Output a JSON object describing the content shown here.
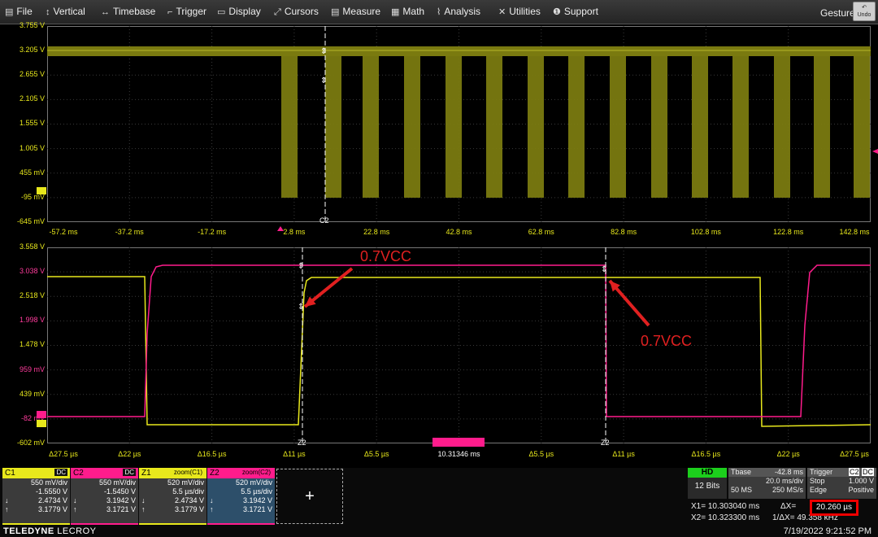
{
  "menu": [
    {
      "icon": "file-icon",
      "glyph": "▤",
      "label": "File"
    },
    {
      "icon": "vertical-icon",
      "glyph": "↕",
      "label": "Vertical"
    },
    {
      "icon": "timebase-icon",
      "glyph": "↔",
      "label": "Timebase"
    },
    {
      "icon": "trigger-icon",
      "glyph": "⌐",
      "label": "Trigger"
    },
    {
      "icon": "display-icon",
      "glyph": "▭",
      "label": "Display"
    },
    {
      "icon": "cursors-icon",
      "glyph": "⤢",
      "label": "Cursors"
    },
    {
      "icon": "measure-icon",
      "glyph": "▤",
      "label": "Measure"
    },
    {
      "icon": "math-icon",
      "glyph": "▦",
      "label": "Math"
    },
    {
      "icon": "analysis-icon",
      "glyph": "⌇",
      "label": "Analysis"
    },
    {
      "icon": "utilities-icon",
      "glyph": "✕",
      "label": "Utilities"
    },
    {
      "icon": "support-icon",
      "glyph": "❶",
      "label": "Support"
    }
  ],
  "gesture_label": "Gesture",
  "undo_label": "Undo",
  "colors": {
    "c1": "#e8e81c",
    "c2": "#ff1c8c",
    "z1": "#e8e81c",
    "z2": "#ff1c8c",
    "trace1": "#7a7a10",
    "red": "#e02020",
    "hd": "#1ccf1c",
    "ax": "#e8e81c",
    "ax2": "#ff3c9c"
  },
  "top_grid": {
    "ylabels": [
      "3.755 V",
      "3.205 V",
      "2.655 V",
      "2.105 V",
      "1.555 V",
      "1.005 V",
      "455 mV",
      "-95 mV",
      "-645 mV"
    ],
    "xlabels": [
      "-57.2 ms",
      "-37.2 ms",
      "-17.2 ms",
      "2.8 ms",
      "22.8 ms",
      "42.8 ms",
      "62.8 ms",
      "82.8 ms",
      "102.8 ms",
      "122.8 ms",
      "142.8 ms"
    ],
    "channel_tag": "C1",
    "cursor_tag": "C2"
  },
  "bottom_grid": {
    "ylabels": [
      "3.558 V",
      "3.038 V",
      "2.518 V",
      "1.998 V",
      "1.478 V",
      "959 mV",
      "439 mV",
      "-82 mV",
      "-602 mV"
    ],
    "xlabels": [
      "Δ27.5 µs",
      "Δ22 µs",
      "Δ16.5 µs",
      "Δ11 µs",
      "Δ5.5 µs",
      "10.31346 ms",
      "Δ5.5 µs",
      "Δ11 µs",
      "Δ16.5 µs",
      "Δ22 µs",
      "Δ27.5 µs"
    ],
    "tags": [
      "Z2",
      "Z1"
    ],
    "cursor_tags": [
      "Z2",
      "Z2"
    ],
    "annotations": [
      "0.7VCC",
      "0.7VCC"
    ]
  },
  "tiles": [
    {
      "name": "C1",
      "dc": "DC",
      "div": "550 mV/div",
      "offset": "-1.5550 V",
      "v1": "2.4734 V",
      "v2": "3.1779 V"
    },
    {
      "name": "C2",
      "dc": "DC",
      "div": "550 mV/div",
      "offset": "-1.5450 V",
      "v1": "3.1942 V",
      "v2": "3.1721 V"
    },
    {
      "name": "Z1",
      "right": "zoom(C1)",
      "div": "520 mV/div",
      "offset": "5.5 µs/div",
      "v1": "2.4734 V",
      "v2": "3.1779 V"
    },
    {
      "name": "Z2",
      "right": "zoom(C2)",
      "div": "520 mV/div",
      "offset": "5.5 µs/div",
      "v1": "3.1942 V",
      "v2": "3.1721 V"
    }
  ],
  "add_label": "+",
  "hd": {
    "label": "HD",
    "bits": "12 Bits"
  },
  "tbase": {
    "label": "Tbase",
    "offset": "-42.8 ms",
    "div": "20.0 ms/div",
    "rate1": "50 MS",
    "rate2": "250 MS/s"
  },
  "trigger": {
    "label": "Trigger",
    "ch": "C2",
    "dc": "DC",
    "mode": "Stop",
    "level": "1.000 V",
    "type": "Edge",
    "slope": "Positive"
  },
  "measure": {
    "x1_label": "X1=",
    "x1": "10.303040 ms",
    "dx_label": "ΔX=",
    "dx": "20.260 µs",
    "x2_label": "X2=",
    "x2": "10.323300 ms",
    "inv_label": "1/ΔX=",
    "inv": "49.358 kHz"
  },
  "brand": {
    "a": "TELEDYNE",
    "b": "LECROY"
  },
  "datetime": "7/19/2022 9:21:52 PM"
}
